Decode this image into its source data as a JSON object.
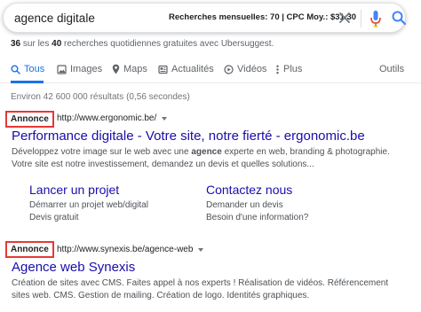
{
  "search": {
    "query": "agence digitale",
    "ubersuggest_stats": "Recherches mensuelles: 70 | CPC Moy.: $31.30"
  },
  "ubersuggest": {
    "used": "36",
    "sep": " sur les ",
    "total": "40",
    "rest": " recherches quotidiennes gratuites avec Ubersuggest."
  },
  "tabs": [
    {
      "label": "Tous",
      "icon": "search-icon",
      "active": true
    },
    {
      "label": "Images",
      "icon": "image-icon"
    },
    {
      "label": "Maps",
      "icon": "map-pin-icon"
    },
    {
      "label": "Actualités",
      "icon": "news-icon"
    },
    {
      "label": "Vidéos",
      "icon": "video-icon"
    },
    {
      "label": "Plus",
      "icon": "more-vert-icon"
    },
    {
      "label": "Outils"
    }
  ],
  "results_stats": "Environ 42 600 000 résultats (0,56 secondes)",
  "ads": [
    {
      "badge": "Annonce",
      "url": "http://www.ergonomic.be/",
      "title": "Performance digitale - Votre site, notre fierté - ergonomic.be",
      "desc_pre": "Développez votre image sur le web avec une ",
      "desc_bold": "agence",
      "desc_post": " experte en web, branding & photographie.",
      "desc_line2": "Votre site est notre investissement, demandez un devis et quelles solutions...",
      "sitelinks": [
        {
          "title": "Lancer un projet",
          "line1": "Démarrer un projet web/digital",
          "line2": "Devis gratuit"
        },
        {
          "title": "Contactez nous",
          "line1": "Demander un devis",
          "line2": "Besoin d'une information?"
        }
      ]
    },
    {
      "badge": "Annonce",
      "url": "http://www.synexis.be/agence-web",
      "title": "Agence web Synexis",
      "desc_line1": "Création de sites avec CMS. Faites appel à nos experts ! Réalisation de vidéos. Référencement",
      "desc_line2": "sites web. CMS. Gestion de mailing. Création de logo. Identités graphiques."
    }
  ],
  "colors": {
    "link": "#1a0dab",
    "accent": "#1a73e8",
    "annotation_box": "#e53935"
  }
}
